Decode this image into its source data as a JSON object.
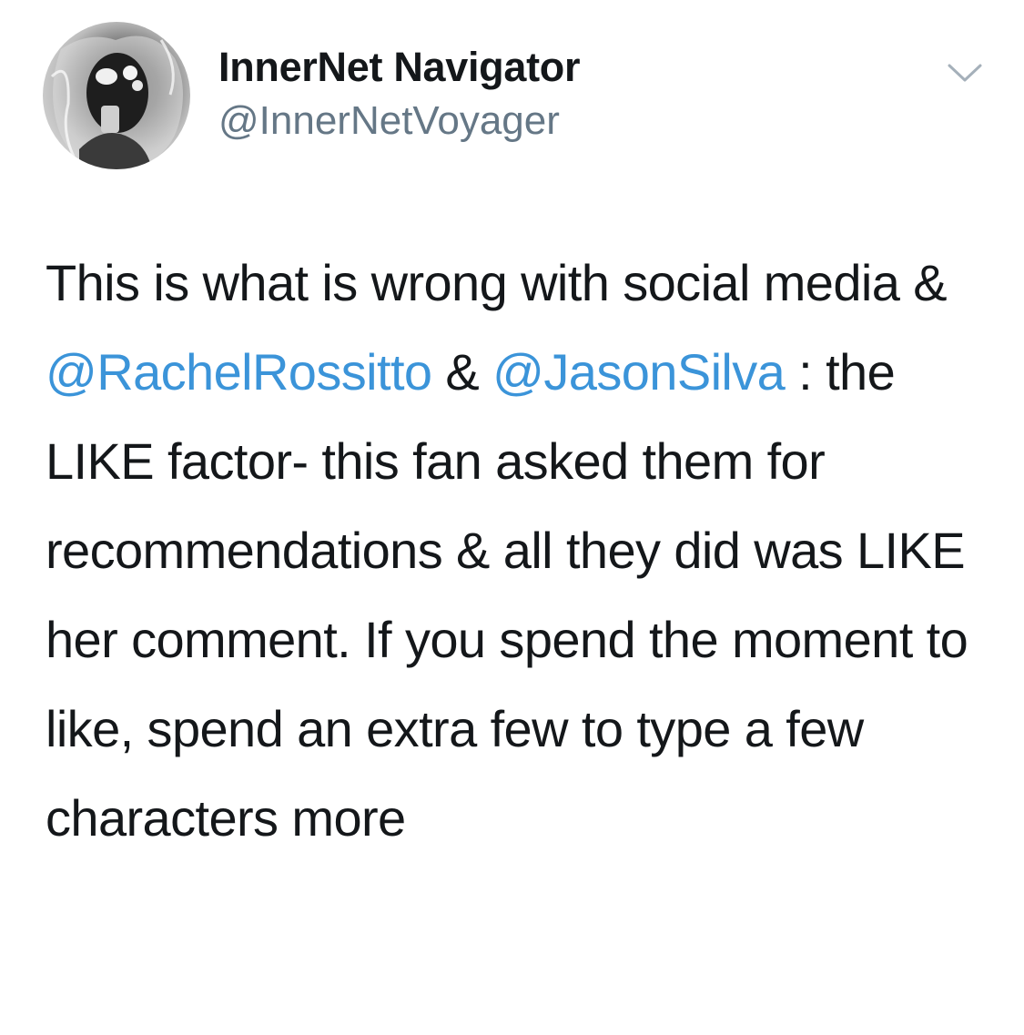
{
  "author": {
    "display_name": "InnerNet Navigator",
    "handle": "@InnerNetVoyager",
    "avatar_icon": "avatar-photo"
  },
  "menu": {
    "icon": "chevron-down-icon"
  },
  "tweet": {
    "seg1": "This is what is wrong with social media & ",
    "mention1": "@RachelRossitto",
    "seg2": " & ",
    "mention2": "@JasonSilva",
    "seg3": " : the LIKE factor- this fan asked them for recommendations & all they did was LIKE her comment. If you spend the moment to like, spend an extra few to type a few characters more"
  },
  "colors": {
    "link": "#3b94d9",
    "text": "#14171a",
    "secondary": "#657786"
  }
}
